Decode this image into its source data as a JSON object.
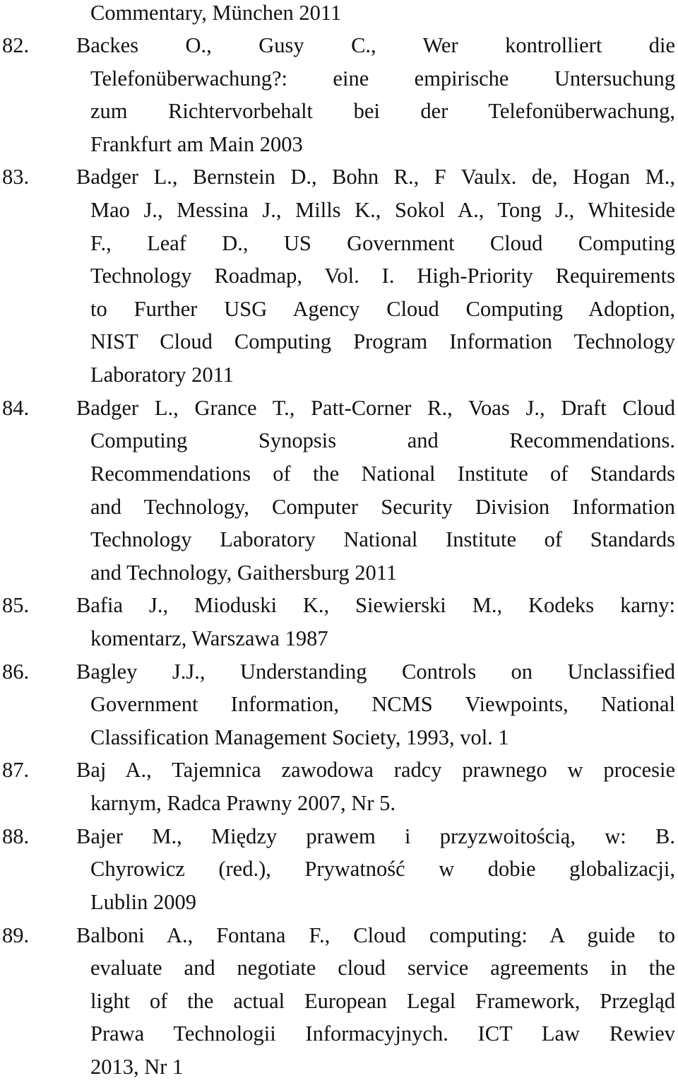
{
  "document": {
    "type": "bibliography",
    "leading_fragment": {
      "lines": [
        "Commentary, München 2011"
      ]
    },
    "entries": [
      {
        "number": "82.",
        "lines": [
          "Backes O., Gusy C., Wer kontrolliert die",
          "Telefonüberwachung?: eine empirische Untersuchung",
          "zum Richtervorbehalt bei der Telefonüberwachung,",
          "Frankfurt am Main 2003"
        ]
      },
      {
        "number": "83.",
        "lines": [
          "Badger L., Bernstein D., Bohn R., F Vaulx. de, Hogan M.,",
          "Mao J., Messina J., Mills K., Sokol A., Tong J., Whiteside",
          "F., Leaf D., US Government Cloud Computing",
          "Technology Roadmap, Vol. I. High-Priority Requirements",
          "to Further USG Agency Cloud Computing Adoption,",
          "NIST Cloud Computing Program Information Technology",
          "Laboratory 2011"
        ]
      },
      {
        "number": "84.",
        "lines": [
          "Badger L., Grance T., Patt-Corner R., Voas J., Draft Cloud",
          "Computing Synopsis and Recommendations.",
          "Recommendations of the National Institute of Standards",
          "and Technology, Computer Security Division Information",
          "Technology Laboratory National Institute of Standards",
          "and Technology, Gaithersburg 2011"
        ]
      },
      {
        "number": "85.",
        "lines": [
          "Bafia J., Mioduski K., Siewierski M., Kodeks karny:",
          "komentarz, Warszawa 1987"
        ]
      },
      {
        "number": "86.",
        "lines": [
          "Bagley J.J., Understanding Controls on Unclassified",
          "Government Information, NCMS Viewpoints, National",
          "Classification Management Society, 1993, vol. 1"
        ]
      },
      {
        "number": "87.",
        "lines": [
          "Baj A., Tajemnica zawodowa radcy prawnego w procesie",
          "karnym, Radca Prawny 2007, Nr 5."
        ]
      },
      {
        "number": "88.",
        "lines": [
          "Bajer M., Między prawem i przyzwoitością, w: B.",
          "Chyrowicz (red.), Prywatność w dobie globalizacji,",
          "Lublin 2009"
        ]
      },
      {
        "number": "89.",
        "lines": [
          "Balboni A., Fontana F., Cloud computing: A guide to",
          "evaluate and negotiate cloud service agreements in the",
          "light of the actual European Legal Framework, Przegląd",
          "Prawa Technologii Informacyjnych. ICT Law Rewiev",
          "2013, Nr 1"
        ]
      }
    ]
  }
}
